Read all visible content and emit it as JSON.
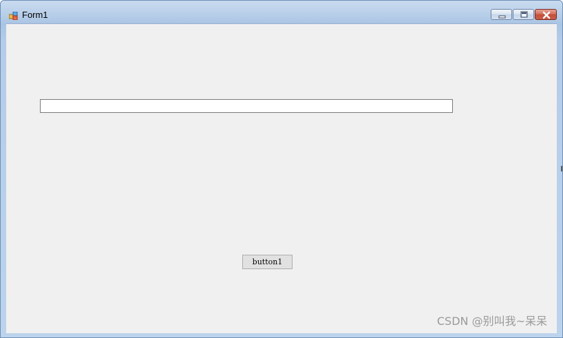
{
  "window": {
    "title": "Form1",
    "icon": "winforms-app-icon",
    "controls": {
      "minimize": "minimize-icon",
      "maximize": "maximize-icon",
      "close": "close-icon"
    }
  },
  "form": {
    "textbox": {
      "value": "",
      "placeholder": ""
    },
    "button": {
      "label": "button1"
    }
  },
  "watermark": {
    "text": "CSDN @别叫我~呆呆"
  },
  "colors": {
    "client_background": "#f0f0f0",
    "title_bar": "#b8cfe9",
    "close_button": "#c24f3a",
    "button_face": "#e1e1e1",
    "watermark": "#9a9a9a"
  }
}
